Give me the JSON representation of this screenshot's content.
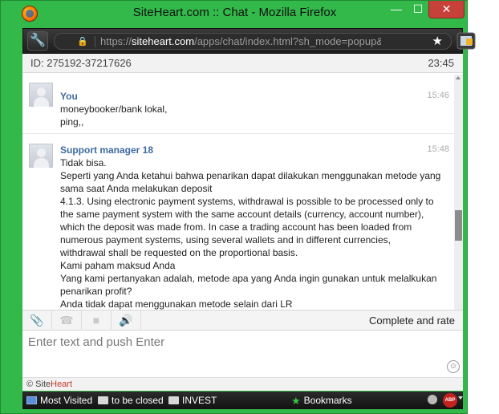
{
  "window": {
    "title": "SiteHeart.com :: Chat - Mozilla Firefox",
    "minimize_glyph": "—",
    "maximize_glyph": "☐",
    "close_glyph": "✕"
  },
  "navbar": {
    "url_prefix": "https://",
    "url_host": "siteheart.com",
    "url_path": "/apps/chat/index.html?sh_mode=popup&ent_id",
    "icons": {
      "tools": "wrench-icon",
      "lock": "lock-icon",
      "bookmark": "star-icon",
      "addon": "addon-icon"
    }
  },
  "chat": {
    "id_label": "ID: 275192-37217626",
    "time": "23:45",
    "messages": [
      {
        "author": "You",
        "time": "15:46",
        "lines": [
          "moneybooker/bank lokal,",
          "ping,,"
        ]
      },
      {
        "author": "Support manager 18",
        "time": "15:48",
        "lines": [
          "Tidak bisa.",
          "Seperti yang Anda ketahui bahwa penarikan dapat dilakukan menggunakan metode yang",
          "sama saat Anda melakukan deposit",
          "4.1.3. Using electronic payment systems, withdrawal is possible to be processed only to",
          "the same payment system with the same account details (currency, account number),",
          "which the deposit was made from. In case a trading account has been loaded from",
          "numerous payment systems, using several wallets and in different currencies,",
          "withdrawal shall be requested on the proportional basis.",
          "Kami paham maksud Anda",
          "Yang kami pertanyakan adalah, metode apa yang Anda ingin gunakan untuk melalkukan",
          "penarikan profit?",
          "Anda tidak dapat menggunakan metode selain dari LR"
        ]
      }
    ]
  },
  "toolbar": {
    "attach_glyph": "📎",
    "call_glyph": "☎",
    "video_glyph": "■",
    "sound_glyph": "🔊",
    "complete_label": "Complete and rate"
  },
  "composer": {
    "value": "",
    "placeholder": "Enter text and push Enter",
    "smile_glyph": "☺"
  },
  "footer": {
    "copyright": "© Site",
    "brand": "Heart"
  },
  "bookmarks": {
    "items": [
      "Most Visited",
      "to be closed",
      "INVEST"
    ],
    "bookmarks_label": "Bookmarks",
    "abp_label": "ABP"
  },
  "colors": {
    "frame": "#33b84a",
    "accent_link": "#3e6aa0",
    "close_button": "#c7413a"
  }
}
